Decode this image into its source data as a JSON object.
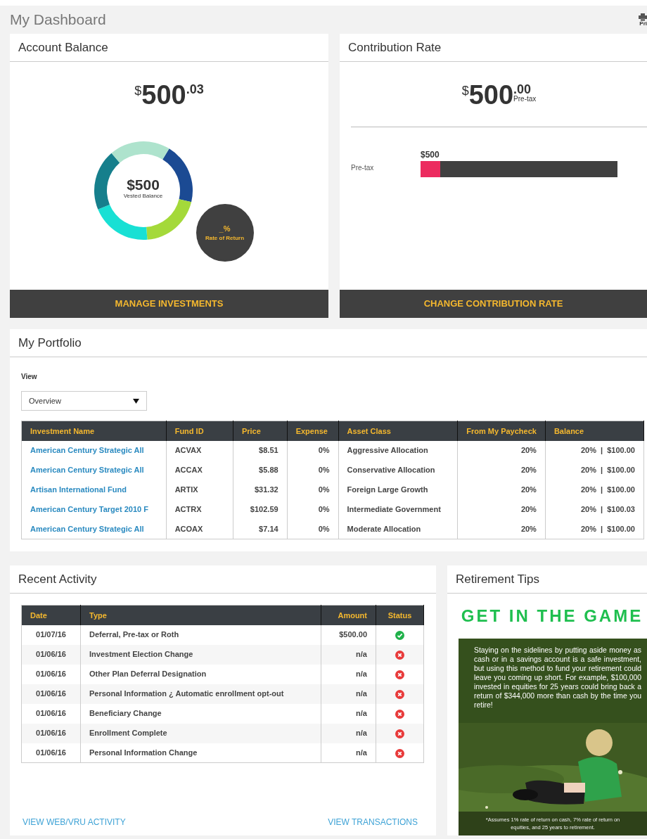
{
  "page": {
    "title": "My Dashboard",
    "print_label": "Pri"
  },
  "account_balance": {
    "title": "Account Balance",
    "currency": "$",
    "amount": "500",
    "cents": ".03",
    "vested_amount": "$500",
    "vested_label": "Vested Balance",
    "rate_value": "_%",
    "rate_label": "Rate of Return",
    "button": "MANAGE INVESTMENTS"
  },
  "contribution_rate": {
    "title": "Contribution Rate",
    "currency": "$",
    "amount": "500",
    "cents": ".00",
    "cents_note": "Pre-tax",
    "bars": [
      {
        "label": "Pre-tax",
        "value": "$500",
        "level": 0.1
      }
    ],
    "button": "CHANGE CONTRIBUTION RATE"
  },
  "portfolio": {
    "title": "My Portfolio",
    "view_label": "View",
    "view_value": "Overview",
    "columns": [
      "Investment Name",
      "Fund ID",
      "Price",
      "Expense",
      "Asset Class",
      "From My Paycheck",
      "Balance"
    ],
    "rows": [
      {
        "name": "American Century Strategic All",
        "fund_id": "ACVAX",
        "price": "$8.51",
        "expense": "0%",
        "asset_class": "Aggressive Allocation",
        "paycheck": "20%",
        "balance": "20%  |  $100.00"
      },
      {
        "name": "American Century Strategic All",
        "fund_id": "ACCAX",
        "price": "$5.88",
        "expense": "0%",
        "asset_class": "Conservative Allocation",
        "paycheck": "20%",
        "balance": "20%  |  $100.00"
      },
      {
        "name": "Artisan International Fund",
        "fund_id": "ARTIX",
        "price": "$31.32",
        "expense": "0%",
        "asset_class": "Foreign Large Growth",
        "paycheck": "20%",
        "balance": "20%  |  $100.00"
      },
      {
        "name": "American Century Target 2010 F",
        "fund_id": "ACTRX",
        "price": "$102.59",
        "expense": "0%",
        "asset_class": "Intermediate Government",
        "paycheck": "20%",
        "balance": "20%  |  $100.03"
      },
      {
        "name": "American Century Strategic All",
        "fund_id": "ACOAX",
        "price": "$7.14",
        "expense": "0%",
        "asset_class": "Moderate Allocation",
        "paycheck": "20%",
        "balance": "20%  |  $100.00"
      }
    ]
  },
  "recent_activity": {
    "title": "Recent Activity",
    "columns": [
      "Date",
      "Type",
      "Amount",
      "Status"
    ],
    "rows": [
      {
        "date": "01/07/16",
        "type": "Deferral, Pre-tax or Roth",
        "amount": "$500.00",
        "complete": true
      },
      {
        "date": "01/06/16",
        "type": "Investment Election Change",
        "amount": "n/a",
        "complete": false
      },
      {
        "date": "01/06/16",
        "type": "Other Plan Deferral Designation",
        "amount": "n/a",
        "complete": false
      },
      {
        "date": "01/06/16",
        "type": "Personal Information ¿ Automatic enrollment opt-out",
        "amount": "n/a",
        "complete": false
      },
      {
        "date": "01/06/16",
        "type": "Beneficiary Change",
        "amount": "n/a",
        "complete": false
      },
      {
        "date": "01/06/16",
        "type": "Enrollment Complete",
        "amount": "n/a",
        "complete": false
      },
      {
        "date": "01/06/16",
        "type": "Personal Information Change",
        "amount": "n/a",
        "complete": false
      }
    ],
    "links": [
      "VIEW WEB/VRU ACTIVITY",
      "VIEW TRANSACTIONS"
    ]
  },
  "retirement_tips": {
    "title": "Retirement Tips",
    "headline": "GET IN THE GAME",
    "body": "Staying on the sidelines by putting aside money as cash or in a savings account is a safe investment, but using this method to fund your retirement could leave you coming up short. For example, $100,000 invested in equities for 25 years could bring back a return of $344,000 more than cash by the time you retire!",
    "footnote": "*Assumes 1% rate of return on cash, 7% rate of return on equities, and 25 years to retirement."
  }
}
